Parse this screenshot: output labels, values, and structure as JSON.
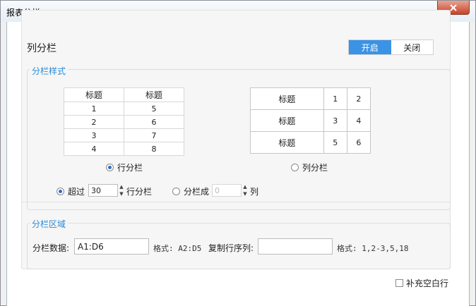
{
  "window": {
    "title": "报表分栏"
  },
  "column_split": {
    "title": "列分栏",
    "toggle": {
      "on_label": "开启",
      "off_label": "关闭"
    }
  },
  "style_group": {
    "legend": "分栏样式",
    "row_preview": {
      "header": [
        "标题",
        "标题"
      ],
      "rows": [
        [
          "1",
          "5"
        ],
        [
          "2",
          "6"
        ],
        [
          "3",
          "7"
        ],
        [
          "4",
          "8"
        ]
      ]
    },
    "col_preview": {
      "rows": [
        [
          "标题",
          "1",
          "2"
        ],
        [
          "标题",
          "3",
          "4"
        ],
        [
          "标题",
          "5",
          "6"
        ]
      ]
    },
    "row_split_label": "行分栏",
    "col_split_label": "列分栏",
    "exceed_label": "超过",
    "exceed_value": "30",
    "exceed_suffix": "行分栏",
    "split_into_label": "分栏成",
    "split_into_value": "0",
    "split_into_suffix": "列"
  },
  "area_group": {
    "legend": "分栏区域",
    "data_label": "分栏数据:",
    "data_value": "A1:D6",
    "format_label_1": "格式: A2:D5",
    "copy_rows_label": "复制行序列:",
    "copy_rows_value": "",
    "format_label_2": "格式: 1,2-3,5,18"
  },
  "fill_blank_label": "补充空白行",
  "colors": {
    "accent": "#3a93e5",
    "legend": "#2a8bd6"
  }
}
